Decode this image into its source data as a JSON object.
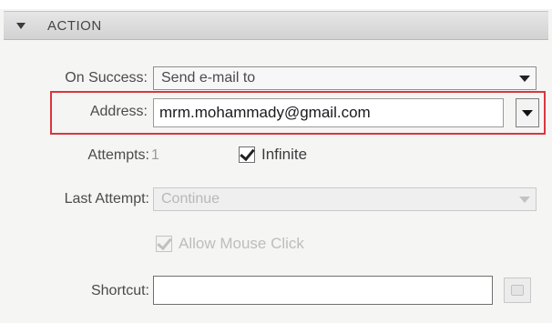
{
  "section": {
    "title": "ACTION"
  },
  "on_success": {
    "label": "On Success:",
    "value": "Send e-mail to"
  },
  "address": {
    "label": "Address:",
    "value": "mrm.mohammady@gmail.com"
  },
  "attempts": {
    "label": "Attempts:",
    "value": "1",
    "infinite_label": "Infinite",
    "infinite_checked": true
  },
  "last_attempt": {
    "label": "Last Attempt:",
    "value": "Continue",
    "enabled": false
  },
  "allow_mouse_click": {
    "label": "Allow Mouse Click",
    "checked": true,
    "enabled": false
  },
  "shortcut": {
    "label": "Shortcut:",
    "value": ""
  },
  "colors": {
    "highlight_border": "#d9363e",
    "panel_bg": "#f5f5f4",
    "header_bg": "#dcdcdc"
  }
}
